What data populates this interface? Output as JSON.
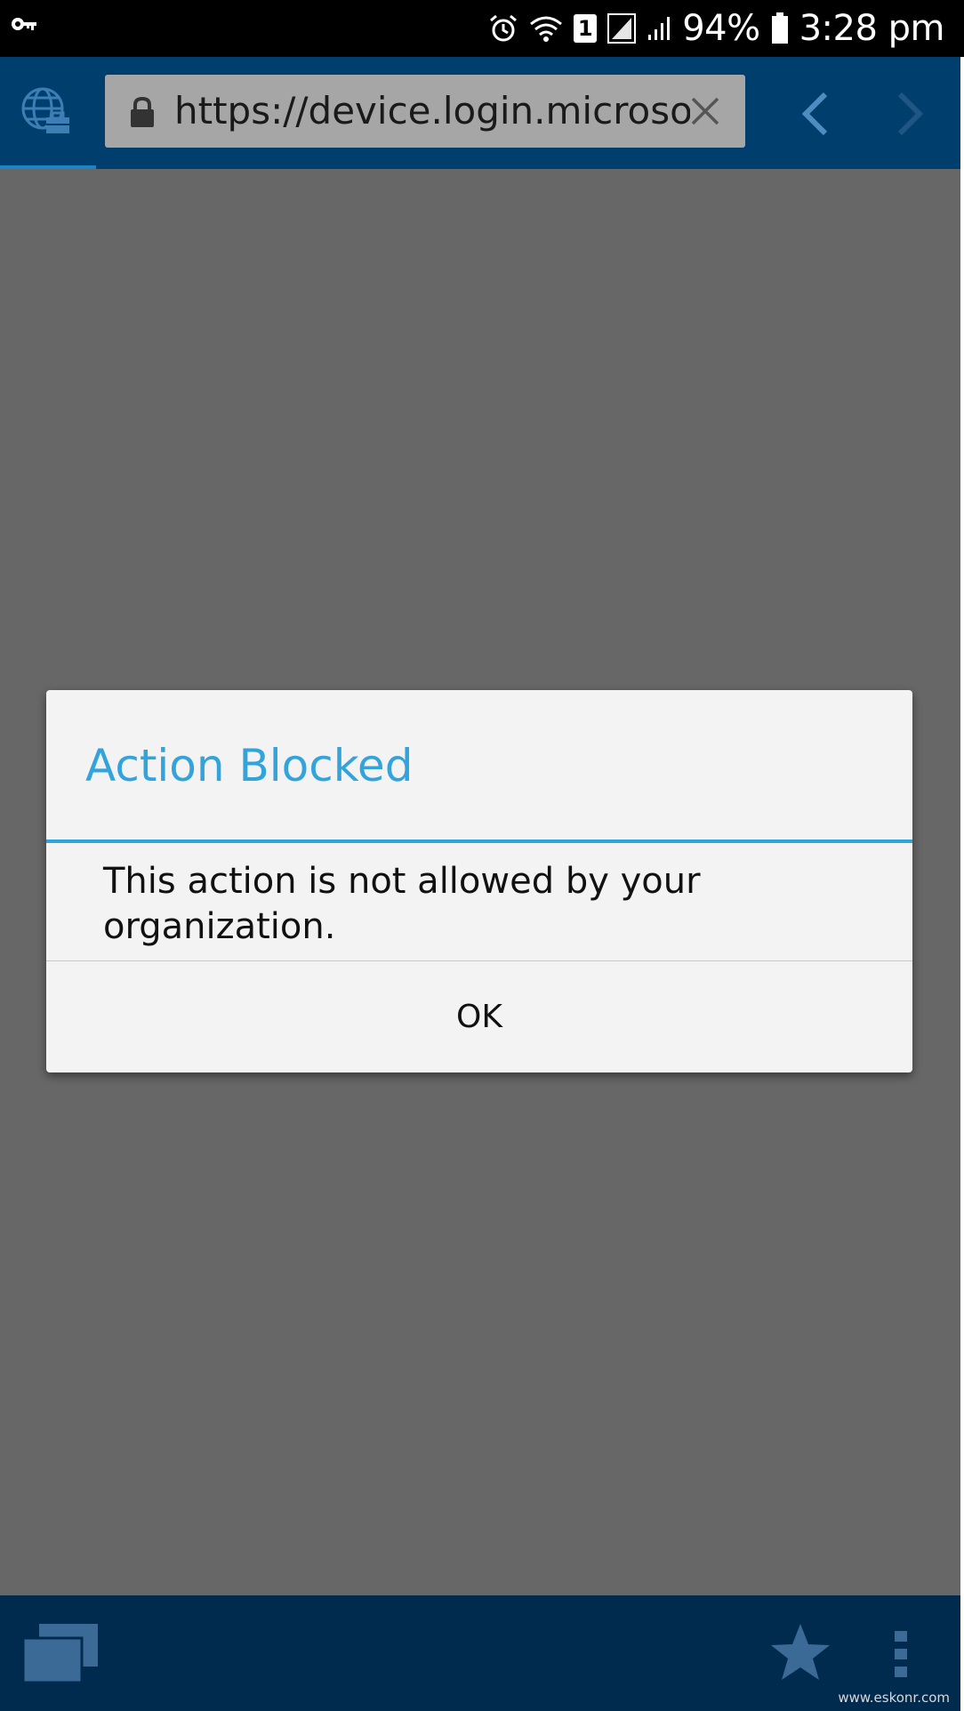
{
  "status_bar": {
    "battery_percent": "94%",
    "time": "3:28 pm",
    "sim_label": "1",
    "icons": [
      "vpn-key-icon",
      "alarm-icon",
      "wifi-icon",
      "sim-icon",
      "signal-icon",
      "signal-icon",
      "battery-icon"
    ]
  },
  "browser": {
    "url": "https://device.login.microsof",
    "icons": [
      "globe-briefcase-icon",
      "lock-icon",
      "clear-icon",
      "back-arrow-icon",
      "forward-arrow-icon"
    ]
  },
  "dialog": {
    "title": "Action Blocked",
    "message": "This action is not allowed by your organization.",
    "ok_label": "OK",
    "accent_color": "#33a3dc"
  },
  "bottom_bar": {
    "icons": [
      "tabs-icon",
      "star-icon",
      "overflow-menu-icon"
    ]
  },
  "watermark": "www.eskonr.com",
  "colors": {
    "toolbar": "#003e6e",
    "bottom_bar": "#002b4e",
    "overlay": "#676767"
  }
}
